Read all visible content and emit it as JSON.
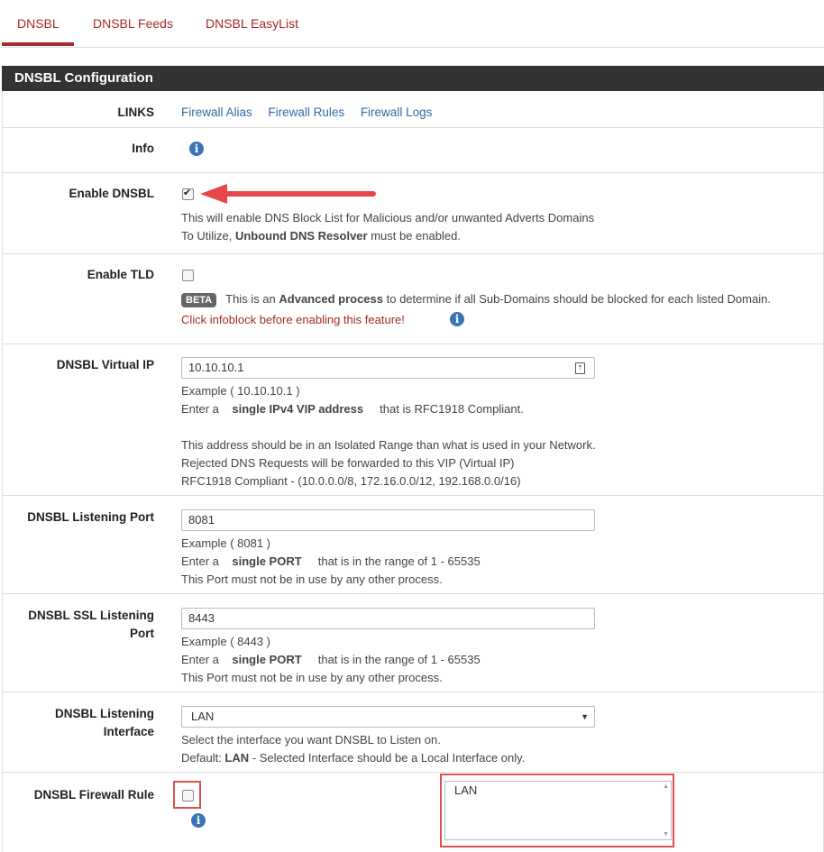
{
  "tabs": [
    {
      "label": "DNSBL"
    },
    {
      "label": "DNSBL Feeds"
    },
    {
      "label": "DNSBL EasyList"
    }
  ],
  "panel": {
    "title": "DNSBL Configuration"
  },
  "links": {
    "label": "LINKS",
    "items": [
      "Firewall Alias",
      "Firewall Rules",
      "Firewall Logs"
    ]
  },
  "info": {
    "label": "Info"
  },
  "enable_dnsbl": {
    "label": "Enable DNSBL",
    "checked": true,
    "help1": "This will enable DNS Block List for Malicious and/or unwanted Adverts Domains",
    "help2_pre": "To Utilize, ",
    "help2_bold": "Unbound DNS Resolver",
    "help2_post": " must be enabled."
  },
  "enable_tld": {
    "label": "Enable TLD",
    "checked": false,
    "badge": "BETA",
    "help1_pre": "This is an ",
    "help1_bold": "Advanced process",
    "help1_post": " to determine if all Sub-Domains should be blocked for each listed Domain.",
    "help2": "Click infoblock before enabling this feature!"
  },
  "virtual_ip": {
    "label": "DNSBL Virtual IP",
    "value": "10.10.10.1",
    "example": "Example ( 10.10.10.1 )",
    "enter_pre": "Enter a",
    "enter_bold": "single IPv4 VIP address",
    "enter_post": "that is RFC1918 Compliant.",
    "help3": "This address should be in an Isolated Range than what is used in your Network.",
    "help4": "Rejected DNS Requests will be forwarded to this VIP (Virtual IP)",
    "help5": "RFC1918 Compliant - (10.0.0.0/8, 172.16.0.0/12, 192.168.0.0/16)"
  },
  "listen_port": {
    "label": "DNSBL Listening Port",
    "value": "8081",
    "example": "Example ( 8081 )",
    "enter_pre": "Enter a",
    "enter_bold": "single PORT",
    "enter_post": "that is in the range of 1 - 65535",
    "help3": "This Port must not be in use by any other process."
  },
  "ssl_port": {
    "label_line1": "DNSBL SSL Listening",
    "label_line2": "Port",
    "value": "8443",
    "example": "Example ( 8443 )",
    "enter_pre": "Enter a",
    "enter_bold": "single PORT",
    "enter_post": "that is in the range of 1 - 65535",
    "help3": "This Port must not be in use by any other process."
  },
  "listen_iface": {
    "label_line1": "DNSBL Listening",
    "label_line2": "Interface",
    "value": "LAN",
    "help1": "Select the interface you want DNSBL to Listen on.",
    "help2_pre": "Default: ",
    "help2_bold": "LAN",
    "help2_post": " - Selected Interface should be a Local Interface only."
  },
  "firewall_rule": {
    "label": "DNSBL Firewall Rule",
    "checked": false,
    "list_value": "LAN"
  },
  "colors": {
    "accent": "#a52a2a",
    "link": "#3469a8",
    "header_bg": "#333333",
    "highlight": "#d9534f",
    "arrow": "#e8474a"
  }
}
